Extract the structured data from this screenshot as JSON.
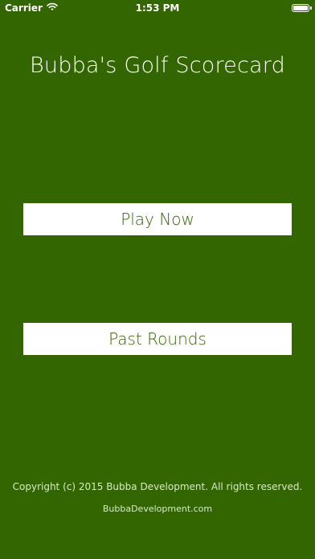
{
  "status_bar": {
    "carrier": "Carrier",
    "time": "1:53 PM",
    "wifi_icon": "wifi-icon",
    "battery_icon": "battery-icon"
  },
  "app": {
    "title": "Bubba's Golf Scorecard",
    "play_label": "Play Now",
    "past_rounds_label": "Past Rounds"
  },
  "footer": {
    "copyright": "Copyright (c) 2015 Bubba Development. All rights reserved.",
    "website": "BubbaDevelopment.com"
  },
  "colors": {
    "background": "#336600",
    "button_background": "#ffffff",
    "button_text": "#336600"
  }
}
